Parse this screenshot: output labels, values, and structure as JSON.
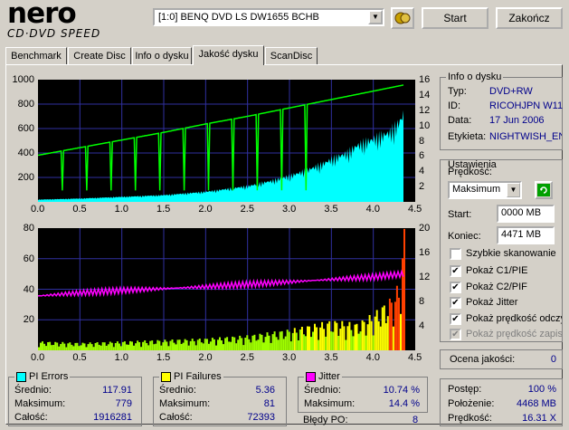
{
  "app": {
    "logo_top": "nero",
    "logo_bottom": "CD·DVD SPEED"
  },
  "toolbar": {
    "drive": "[1:0]  BENQ DVD LS DW1655 BCHB",
    "start_label": "Start",
    "close_label": "Zakończ"
  },
  "tabs": [
    {
      "label": "Benchmark"
    },
    {
      "label": "Create Disc"
    },
    {
      "label": "Info o dysku"
    },
    {
      "label": "Jakość dysku"
    },
    {
      "label": "ScanDisc"
    }
  ],
  "disc_info": {
    "title": "Info o dysku",
    "type_label": "Typ:",
    "type_value": "DVD+RW",
    "id_label": "ID:",
    "id_value": "RICOHJPN W11",
    "date_label": "Data:",
    "date_value": "17 Jun 2006",
    "label_label": "Etykieta:",
    "label_value": "NIGHTWISH_EN"
  },
  "settings": {
    "title": "Ustawienia",
    "speed_label": "Prędkość:",
    "speed_value": "Maksimum",
    "start_label": "Start:",
    "start_value": "0000 MB",
    "end_label": "Koniec:",
    "end_value": "4471 MB",
    "options": [
      {
        "label": "Szybkie skanowanie",
        "checked": false,
        "enabled": true
      },
      {
        "label": "Pokaż C1/PIE",
        "checked": true,
        "enabled": true
      },
      {
        "label": "Pokaż C2/PIF",
        "checked": true,
        "enabled": true
      },
      {
        "label": "Pokaż Jitter",
        "checked": true,
        "enabled": true
      },
      {
        "label": "Pokaż prędkość odczytu",
        "checked": true,
        "enabled": true
      },
      {
        "label": "Pokaż prędkość zapisu",
        "checked": true,
        "enabled": false
      }
    ]
  },
  "quality": {
    "label": "Ocena jakości:",
    "value": "0"
  },
  "progress": {
    "progress_label": "Postęp:",
    "progress_value": "100 %",
    "position_label": "Położenie:",
    "position_value": "4468 MB",
    "speed_label": "Prędkość:",
    "speed_value": "16.31 X"
  },
  "stats": {
    "pi_errors": {
      "title": "PI Errors",
      "color": "#00ffff",
      "avg_label": "Średnio:",
      "avg": "117.91",
      "max_label": "Maksimum:",
      "max": "779",
      "total_label": "Całość:",
      "total": "1916281"
    },
    "pi_failures": {
      "title": "PI Failures",
      "color": "#ffff00",
      "avg_label": "Średnio:",
      "avg": "5.36",
      "max_label": "Maksimum:",
      "max": "81",
      "total_label": "Całość:",
      "total": "72393"
    },
    "jitter": {
      "title": "Jitter",
      "color": "#ff00ff",
      "avg_label": "Średnio:",
      "avg": "10.74 %",
      "max_label": "Maksimum:",
      "max": "14.4 %",
      "po_label": "Błędy PO:",
      "po": "8"
    }
  },
  "chart_data": [
    {
      "type": "area",
      "x_ticks": [
        "0.0",
        "0.5",
        "1.0",
        "1.5",
        "2.0",
        "2.5",
        "3.0",
        "3.5",
        "4.0",
        "4.5"
      ],
      "y_left_ticks": [
        "1000",
        "800",
        "600",
        "400",
        "200"
      ],
      "y_right_ticks": [
        "16",
        "14",
        "12",
        "10",
        "8",
        "6",
        "4",
        "2"
      ],
      "xlim": [
        0,
        4.5
      ],
      "ylim": [
        0,
        1000
      ],
      "y2lim": [
        0,
        16
      ],
      "series": [
        {
          "color": "#00ffff",
          "x": [
            0,
            0.5,
            1.0,
            1.5,
            2.0,
            2.5,
            2.8,
            3.0,
            3.2,
            3.4,
            3.5,
            3.7,
            3.8,
            4.0,
            4.2,
            4.3,
            4.36
          ],
          "values": [
            20,
            30,
            45,
            60,
            90,
            140,
            190,
            230,
            280,
            340,
            380,
            440,
            500,
            560,
            620,
            700,
            779
          ]
        },
        {
          "color": "#00ff00",
          "x": [
            0,
            0.5,
            1.0,
            1.5,
            2.0,
            2.5,
            3.0,
            3.5,
            4.0,
            4.36
          ],
          "values": [
            6.1,
            7.1,
            8.1,
            9.1,
            10.2,
            11.2,
            12.3,
            13.4,
            14.5,
            15.3
          ]
        }
      ]
    },
    {
      "type": "bar",
      "x_ticks": [
        "0.0",
        "0.5",
        "1.0",
        "1.5",
        "2.0",
        "2.5",
        "3.0",
        "3.5",
        "4.0",
        "4.5"
      ],
      "y_left_ticks": [
        "80",
        "60",
        "40",
        "20"
      ],
      "y_right_ticks": [
        "20",
        "16",
        "12",
        "8",
        "4"
      ],
      "xlim": [
        0,
        4.5
      ],
      "ylim": [
        0,
        80
      ],
      "y2lim": [
        0,
        20
      ],
      "series": [
        {
          "color": "#ffff00",
          "x": [
            0,
            0.5,
            1.0,
            1.5,
            2.0,
            2.5,
            3.0,
            3.5,
            3.8,
            4.0,
            4.2,
            4.3,
            4.36
          ],
          "values": [
            6,
            5,
            6,
            7,
            8,
            10,
            14,
            20,
            18,
            25,
            35,
            45,
            81
          ]
        },
        {
          "color": "#ff00ff",
          "x": [
            0,
            0.5,
            1.0,
            1.5,
            2.0,
            2.5,
            3.0,
            3.5,
            4.0,
            4.36
          ],
          "values": [
            8.9,
            9.4,
            9.8,
            10.1,
            10.4,
            10.8,
            11.2,
            11.6,
            12.0,
            12.5
          ]
        }
      ]
    }
  ]
}
